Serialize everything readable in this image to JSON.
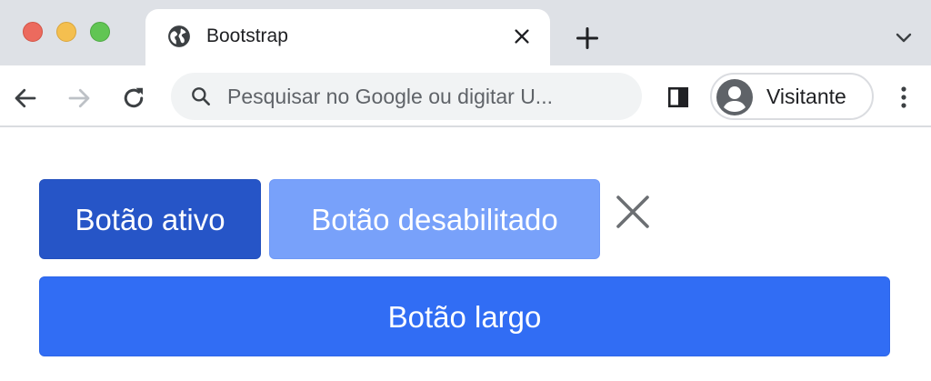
{
  "window": {
    "traffic_lights": [
      "close",
      "minimize",
      "zoom"
    ]
  },
  "tab": {
    "title": "Bootstrap",
    "icon": "globe-icon"
  },
  "toolbar": {
    "omnibox_placeholder": "Pesquisar no Google ou digitar U...",
    "profile_label": "Visitante"
  },
  "page": {
    "active_button_label": "Botão ativo",
    "disabled_button_label": "Botão desabilitado",
    "wide_button_label": "Botão largo"
  },
  "colors": {
    "tabstrip": "#dee1e6",
    "active_button": "#2655c7",
    "disabled_button": "#78a1fa",
    "wide_button": "#316df4"
  }
}
